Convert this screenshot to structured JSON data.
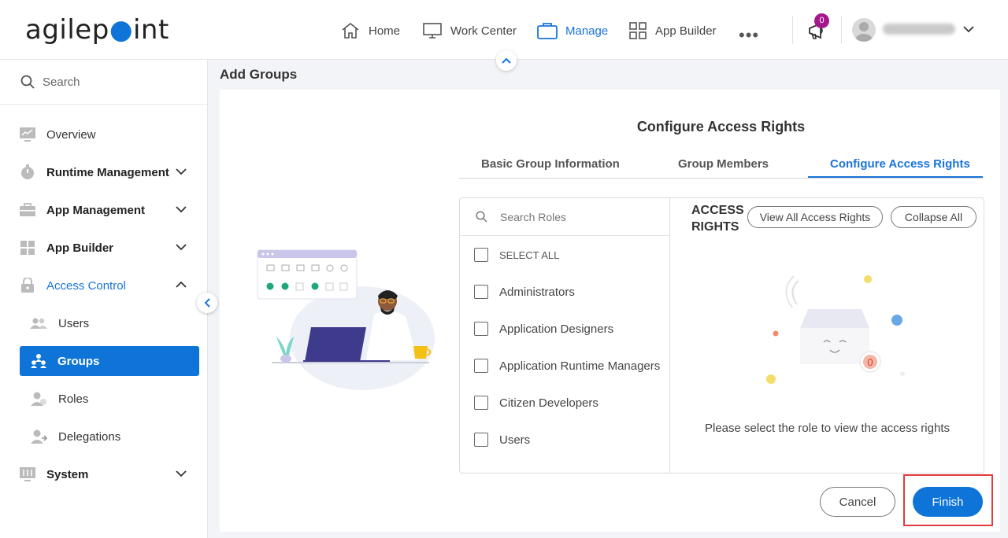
{
  "header": {
    "logo_text_a": "agilep",
    "logo_text_b": "int",
    "nav": [
      {
        "label": "Home",
        "icon": "home-icon"
      },
      {
        "label": "Work Center",
        "icon": "monitor-icon"
      },
      {
        "label": "Manage",
        "icon": "briefcase-icon",
        "active": true
      },
      {
        "label": "App Builder",
        "icon": "grid-icon"
      }
    ],
    "more": "•••",
    "notification_count": "0"
  },
  "sidebar": {
    "search_placeholder": "Search",
    "items": [
      {
        "label": "Overview",
        "icon": "chart-icon"
      },
      {
        "label": "Runtime Management",
        "icon": "stopwatch-icon",
        "expandable": true
      },
      {
        "label": "App Management",
        "icon": "briefcase-icon",
        "expandable": true
      },
      {
        "label": "App Builder",
        "icon": "grid-icon",
        "expandable": true
      },
      {
        "label": "Access Control",
        "icon": "lock-icon",
        "expanded": true
      },
      {
        "label": "Users",
        "icon": "users-icon"
      },
      {
        "label": "Groups",
        "icon": "group-icon",
        "selected": true
      },
      {
        "label": "Roles",
        "icon": "roles-icon"
      },
      {
        "label": "Delegations",
        "icon": "delegation-icon"
      },
      {
        "label": "System",
        "icon": "system-icon",
        "expandable": true
      }
    ]
  },
  "main": {
    "page_title": "Add Groups",
    "section_title": "Configure Access Rights",
    "tabs": [
      {
        "label": "Basic Group Information"
      },
      {
        "label": "Group Members"
      },
      {
        "label": "Configure Access Rights",
        "active": true
      }
    ],
    "roles": {
      "search_placeholder": "Search Roles",
      "select_all": "SELECT ALL",
      "items": [
        "Administrators",
        "Application Designers",
        "Application Runtime Managers",
        "Citizen Developers",
        "Users"
      ]
    },
    "access_rights": {
      "title_line1": "ACCESS",
      "title_line2": "RIGHTS",
      "view_all_label": "View All Access Rights",
      "collapse_all_label": "Collapse All",
      "empty_count": "0",
      "empty_message": "Please select the role to view the access rights"
    },
    "cancel_label": "Cancel",
    "finish_label": "Finish"
  },
  "colors": {
    "accent": "#0f74d8",
    "badge": "#a4188c",
    "highlight": "#e23b3b"
  }
}
